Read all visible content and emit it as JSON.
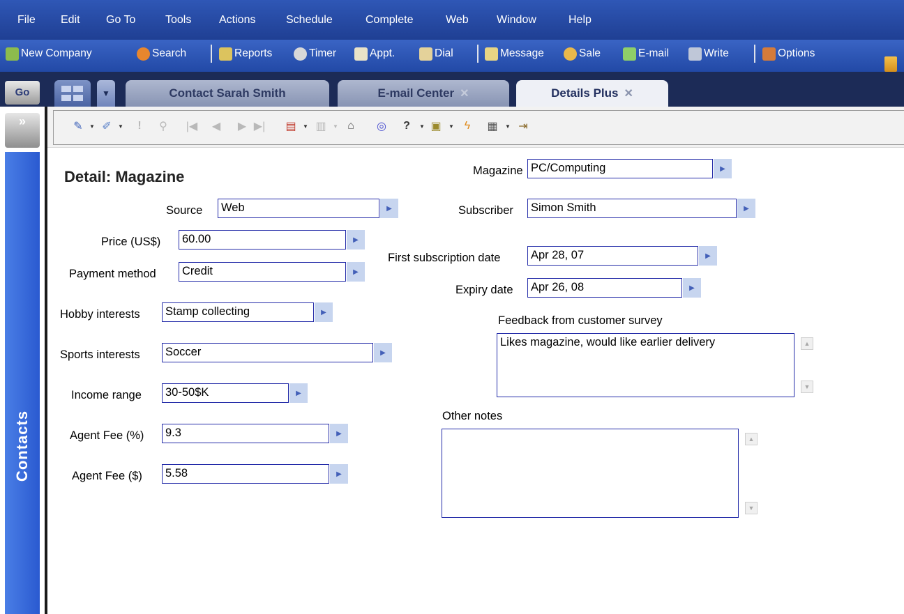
{
  "menu": [
    "File",
    "Edit",
    "Go To",
    "Tools",
    "Actions",
    "Schedule",
    "Complete",
    "Web",
    "Window",
    "Help"
  ],
  "toolbar": [
    {
      "label": "New Company",
      "icon": "new-company-icon"
    },
    {
      "label": "Search",
      "icon": "search-icon"
    },
    {
      "label": "Reports",
      "icon": "reports-icon"
    },
    {
      "label": "Timer",
      "icon": "timer-icon"
    },
    {
      "label": "Appt.",
      "icon": "appointment-icon"
    },
    {
      "label": "Dial",
      "icon": "dial-icon"
    },
    {
      "label": "Message",
      "icon": "message-icon"
    },
    {
      "label": "Sale",
      "icon": "sale-icon"
    },
    {
      "label": "E-mail",
      "icon": "email-icon"
    },
    {
      "label": "Write",
      "icon": "write-icon"
    },
    {
      "label": "Options",
      "icon": "options-icon"
    }
  ],
  "nav": {
    "go_label": "Go",
    "expand_label": "»",
    "side_label": "Contacts",
    "tabs": [
      {
        "label": "Contact Sarah Smith",
        "active": false,
        "closable": false
      },
      {
        "label": "E-mail Center",
        "active": false,
        "closable": true
      },
      {
        "label": "Details Plus",
        "active": true,
        "closable": true
      }
    ]
  },
  "form": {
    "title": "Detail: Magazine",
    "fields": {
      "source": {
        "label": "Source",
        "value": "Web"
      },
      "price": {
        "label": "Price (US$)",
        "value": "60.00"
      },
      "payment": {
        "label": "Payment method",
        "value": "Credit"
      },
      "hobby": {
        "label": "Hobby interests",
        "value": "Stamp collecting"
      },
      "sports": {
        "label": "Sports interests",
        "value": "Soccer"
      },
      "income": {
        "label": "Income range",
        "value": "30-50$K"
      },
      "agent_fee_pct": {
        "label": "Agent Fee (%)",
        "value": "9.3"
      },
      "agent_fee_usd": {
        "label": "Agent Fee ($)",
        "value": "5.58"
      },
      "magazine": {
        "label": "Magazine",
        "value": "PC/Computing"
      },
      "subscriber": {
        "label": "Subscriber",
        "value": "Simon Smith"
      },
      "first_date": {
        "label": "First subscription date",
        "value": "Apr 28, 07"
      },
      "expiry": {
        "label": "Expiry date",
        "value": "Apr 26, 08"
      }
    },
    "feedback": {
      "label": "Feedback from customer survey",
      "value": "Likes magazine, would like earlier delivery"
    },
    "notes": {
      "label": "Other notes",
      "value": ""
    }
  },
  "colors": {
    "menu_bg": "#2548a8",
    "field_border": "#222aa8",
    "arrow_bg": "#c7d5ef",
    "side_bar": "#3a6cdc"
  }
}
